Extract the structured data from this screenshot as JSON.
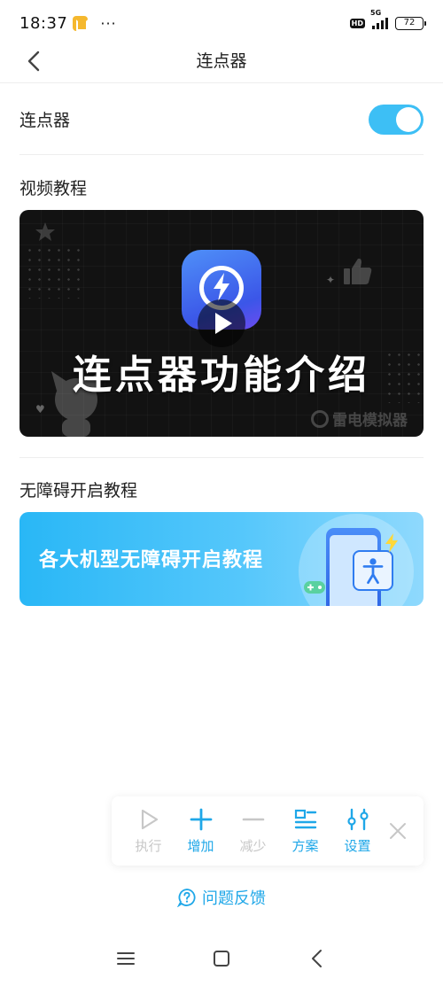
{
  "status_bar": {
    "time": "18:37",
    "dots": "···",
    "hd": "HD",
    "network": "5G",
    "battery": "72"
  },
  "header": {
    "title": "连点器"
  },
  "setting": {
    "label": "连点器",
    "enabled": true
  },
  "video_section": {
    "title": "视频教程",
    "headline": "连点器功能介绍",
    "watermark": "雷电模拟器"
  },
  "accessibility_section": {
    "title": "无障碍开启教程",
    "banner_text": "各大机型无障碍开启教程"
  },
  "toolbar": {
    "run_label": "执行",
    "add_label": "增加",
    "remove_label": "减少",
    "plan_label": "方案",
    "settings_label": "设置"
  },
  "feedback": {
    "label": "问题反馈"
  },
  "colors": {
    "accent": "#1fa7e8",
    "toggle": "#3dbff5",
    "disabled": "#c7c7c7"
  },
  "icons": [
    "back-icon",
    "play-icon",
    "plus-icon",
    "minus-icon",
    "list-icon",
    "sliders-icon",
    "close-icon",
    "question-icon",
    "menu-icon",
    "home-icon"
  ]
}
